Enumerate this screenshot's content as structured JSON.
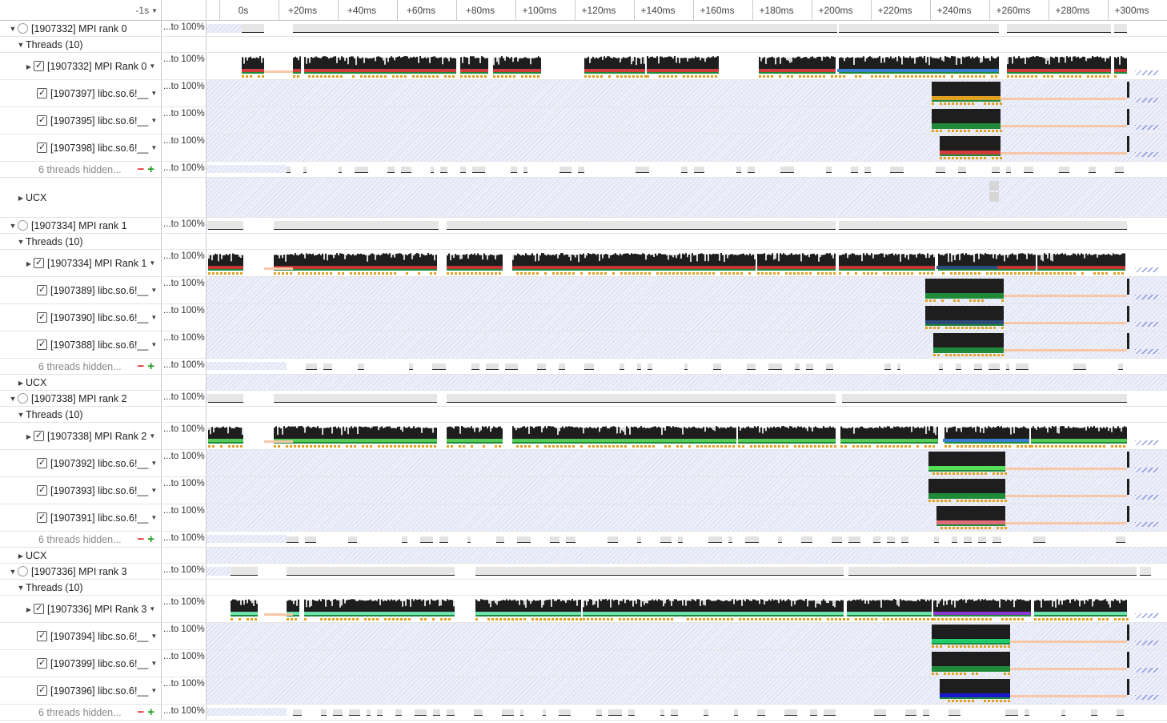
{
  "toolbar": {
    "zoom_label": "-1s"
  },
  "ruler": {
    "ticks": [
      "0s",
      "+20ms",
      "+40ms",
      "+60ms",
      "+80ms",
      "+100ms",
      "+120ms",
      "+140ms",
      "+160ms",
      "+180ms",
      "+200ms",
      "+220ms",
      "+240ms",
      "+260ms",
      "+280ms",
      "+300ms"
    ]
  },
  "scale_label": "...to 100%",
  "rows": [
    {
      "kind": "process",
      "label": "[1907332] MPI rank 0",
      "scale": true,
      "h": 20
    },
    {
      "kind": "group",
      "label": "Threads (10)",
      "h": 20
    },
    {
      "kind": "main",
      "label": "[1907332] MPI Rank 0",
      "scale": true,
      "h": 34,
      "rank": 0
    },
    {
      "kind": "thread",
      "label": "[1907397] libc.so.6!__",
      "scale": true,
      "h": 34,
      "rank": 0,
      "t": 0
    },
    {
      "kind": "thread",
      "label": "[1907395] libc.so.6!__",
      "scale": true,
      "h": 34,
      "rank": 0,
      "t": 1
    },
    {
      "kind": "thread",
      "label": "[1907398] libc.so.6!__",
      "scale": true,
      "h": 34,
      "rank": 0,
      "t": 2
    },
    {
      "kind": "hidden",
      "label": "6 threads hidden...",
      "scale": true,
      "h": 20
    },
    {
      "kind": "ucx",
      "label": "UCX",
      "h": 50,
      "big": true
    },
    {
      "kind": "process",
      "label": "[1907334] MPI rank 1",
      "scale": true,
      "h": 20
    },
    {
      "kind": "group",
      "label": "Threads (10)",
      "h": 20
    },
    {
      "kind": "main",
      "label": "[1907334] MPI Rank 1",
      "scale": true,
      "h": 34,
      "rank": 1
    },
    {
      "kind": "thread",
      "label": "[1907389] libc.so.6!__",
      "scale": true,
      "h": 34,
      "rank": 1,
      "t": 0
    },
    {
      "kind": "thread",
      "label": "[1907390] libc.so.6!__",
      "scale": true,
      "h": 34,
      "rank": 1,
      "t": 1
    },
    {
      "kind": "thread",
      "label": "[1907388] libc.so.6!__",
      "scale": true,
      "h": 34,
      "rank": 1,
      "t": 2
    },
    {
      "kind": "hidden",
      "label": "6 threads hidden...",
      "scale": true,
      "h": 20
    },
    {
      "kind": "ucx",
      "label": "UCX",
      "h": 20
    },
    {
      "kind": "process",
      "label": "[1907338] MPI rank 2",
      "scale": true,
      "h": 20
    },
    {
      "kind": "group",
      "label": "Threads (10)",
      "h": 20
    },
    {
      "kind": "main",
      "label": "[1907338] MPI Rank 2",
      "scale": true,
      "h": 34,
      "rank": 2
    },
    {
      "kind": "thread",
      "label": "[1907392] libc.so.6!__",
      "scale": true,
      "h": 34,
      "rank": 2,
      "t": 0
    },
    {
      "kind": "thread",
      "label": "[1907393] libc.so.6!__",
      "scale": true,
      "h": 34,
      "rank": 2,
      "t": 1
    },
    {
      "kind": "thread",
      "label": "[1907391] libc.so.6!__",
      "scale": true,
      "h": 34,
      "rank": 2,
      "t": 2
    },
    {
      "kind": "hidden",
      "label": "6 threads hidden...",
      "scale": true,
      "h": 20
    },
    {
      "kind": "ucx",
      "label": "UCX",
      "h": 20
    },
    {
      "kind": "process",
      "label": "[1907336] MPI rank 3",
      "scale": true,
      "h": 20
    },
    {
      "kind": "group",
      "label": "Threads (10)",
      "h": 20
    },
    {
      "kind": "main",
      "label": "[1907336] MPI Rank 3",
      "scale": true,
      "h": 34,
      "rank": 3
    },
    {
      "kind": "thread",
      "label": "[1907394] libc.so.6!__",
      "scale": true,
      "h": 34,
      "rank": 3,
      "t": 0
    },
    {
      "kind": "thread",
      "label": "[1907399] libc.so.6!__",
      "scale": true,
      "h": 34,
      "rank": 3,
      "t": 1
    },
    {
      "kind": "thread",
      "label": "[1907396] libc.so.6!__",
      "scale": true,
      "h": 34,
      "rank": 3,
      "t": 2
    },
    {
      "kind": "hidden",
      "label": "6 threads hidden...",
      "scale": true,
      "h": 20
    }
  ],
  "colors": {
    "cpu": "#1e1e1e",
    "cpu_idle": "#d8d8d8",
    "wait": "#f7c7a8",
    "io": "#e0a020",
    "rank_main": [
      "#d23b3b",
      "#c03535",
      "#55cc55",
      "#6fe0b0"
    ],
    "rank_alt": [
      "#3a7fd0",
      "#2c4a7a",
      "#3a7fd0",
      "#8a3ad0"
    ],
    "green": "#1f8a3a",
    "blue": "#1a1ad0"
  }
}
